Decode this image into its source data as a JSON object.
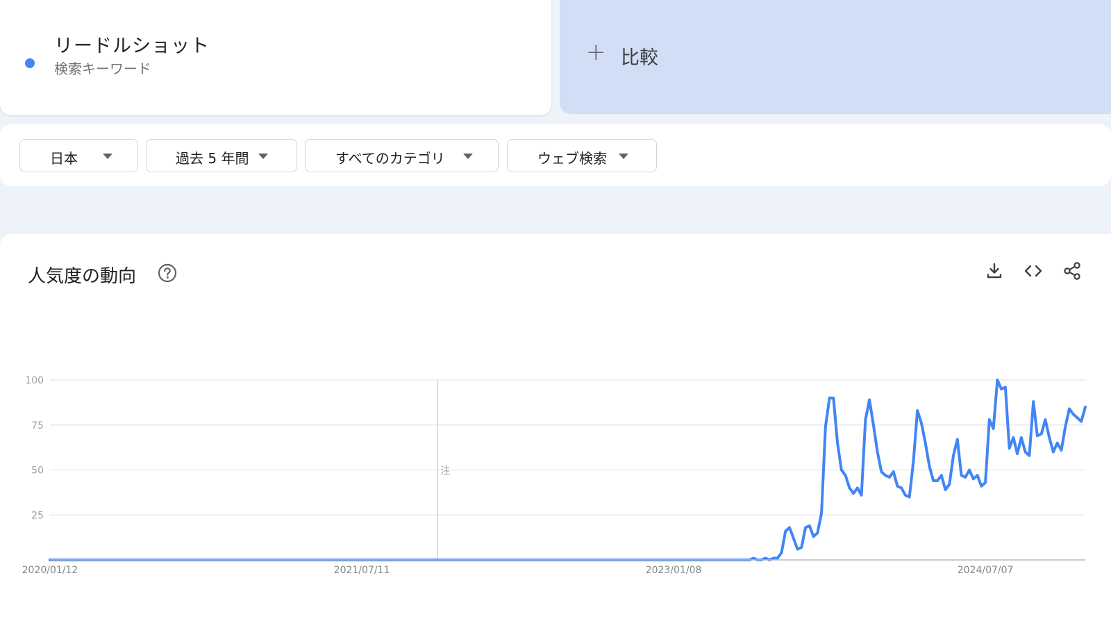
{
  "term": {
    "name": "リードルショット",
    "type": "検索キーワード",
    "color": "#4285f4"
  },
  "compare": {
    "icon": "plus-icon",
    "label": "比較"
  },
  "filters": [
    {
      "label": "日本"
    },
    {
      "label": "過去 5 年間"
    },
    {
      "label": "すべてのカテゴリ"
    },
    {
      "label": "ウェブ検索"
    }
  ],
  "chart_section": {
    "title": "人気度の動向",
    "help_icon": "help-circle-icon",
    "tools": [
      "download-icon",
      "embed-code-icon",
      "share-icon"
    ]
  },
  "chart_data": {
    "type": "line",
    "title": "",
    "xlabel": "",
    "ylabel": "",
    "ylim": [
      0,
      100
    ],
    "yticks": [
      25,
      50,
      75,
      100
    ],
    "xtick_labels": [
      "2020/01/12",
      "2021/07/11",
      "2023/01/08",
      "2024/07/07"
    ],
    "annotation": {
      "label": "注",
      "x": "2021/11/21"
    },
    "grid": true,
    "legend": "none",
    "series": [
      {
        "color": "#4285f4",
        "x": [
          "2020/01/12",
          "2023/05/21",
          "2023/05/28",
          "2023/06/04",
          "2023/06/11",
          "2023/06/18",
          "2023/06/25",
          "2023/07/02",
          "2023/07/09",
          "2023/07/16",
          "2023/07/23",
          "2023/07/30",
          "2023/08/06",
          "2023/08/13",
          "2023/08/20",
          "2023/08/27",
          "2023/09/03",
          "2023/09/10",
          "2023/09/17",
          "2023/09/24",
          "2023/10/01",
          "2023/10/08",
          "2023/10/15",
          "2023/10/22",
          "2023/10/29",
          "2023/11/05",
          "2023/11/12",
          "2023/11/19",
          "2023/11/26",
          "2023/12/03",
          "2023/12/10",
          "2023/12/17",
          "2023/12/24",
          "2023/12/31",
          "2024/01/07",
          "2024/01/14",
          "2024/01/21",
          "2024/01/28",
          "2024/02/04",
          "2024/02/11",
          "2024/02/18",
          "2024/02/25",
          "2024/03/03",
          "2024/03/10",
          "2024/03/17",
          "2024/03/24",
          "2024/03/31",
          "2024/04/07",
          "2024/04/14",
          "2024/04/21",
          "2024/04/28",
          "2024/05/05",
          "2024/05/12",
          "2024/05/19",
          "2024/05/26",
          "2024/06/02",
          "2024/06/09",
          "2024/06/16",
          "2024/06/23",
          "2024/06/30",
          "2024/07/07",
          "2024/07/14",
          "2024/07/21",
          "2024/07/28",
          "2024/08/04",
          "2024/08/11",
          "2024/08/18",
          "2024/08/25",
          "2024/09/01",
          "2024/09/08",
          "2024/09/15",
          "2024/09/22",
          "2024/09/29",
          "2024/10/06",
          "2024/10/13",
          "2024/10/20",
          "2024/10/27",
          "2024/11/03",
          "2024/11/10",
          "2024/11/17",
          "2024/11/24",
          "2024/12/01",
          "2024/12/08",
          "2024/12/15",
          "2024/12/22",
          "2024/12/29"
        ],
        "values": [
          0,
          0,
          1,
          0,
          0,
          1,
          0,
          1,
          1,
          4,
          16,
          18,
          12,
          6,
          7,
          18,
          19,
          13,
          15,
          26,
          74,
          90,
          90,
          65,
          50,
          47,
          40,
          37,
          40,
          36,
          78,
          89,
          75,
          60,
          49,
          47,
          46,
          49,
          41,
          40,
          36,
          35,
          55,
          83,
          76,
          65,
          52,
          44,
          44,
          47,
          39,
          42,
          58,
          67,
          47,
          46,
          50,
          45,
          47,
          41,
          43,
          78,
          73,
          100,
          95,
          96,
          62,
          68,
          59,
          68,
          60,
          58,
          88,
          69,
          70,
          78,
          68,
          60,
          65,
          61,
          74,
          84,
          81,
          79,
          77,
          85
        ]
      }
    ]
  }
}
